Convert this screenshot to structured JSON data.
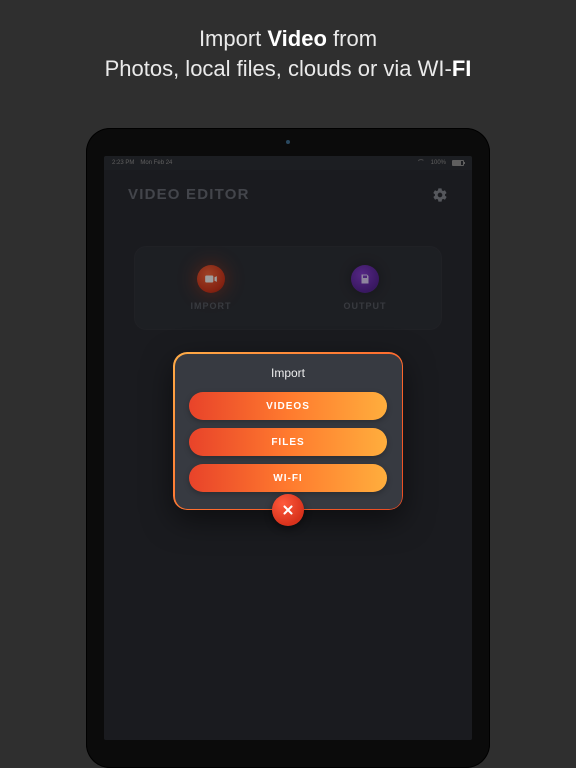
{
  "caption": {
    "l1_pre": "Import ",
    "l1_bold": "Video",
    "l1_post": " from",
    "l2_pre": "Photos, local files, clouds or via WI-",
    "l2_bold": "FI"
  },
  "statusbar": {
    "time": "2:23 PM",
    "date": "Mon Feb 24",
    "battery_pct": "100%"
  },
  "header": {
    "title": "VIDEO EDITOR"
  },
  "tiles": {
    "import_label": "IMPORT",
    "output_label": "OUTPUT"
  },
  "modal": {
    "title": "Import",
    "options": [
      "VIDEOS",
      "FILES",
      "WI-FI"
    ]
  },
  "colors": {
    "page_bg": "#2f2f2f",
    "screen_bg": "#2a2d33",
    "panel_bg": "#303239",
    "modal_bg": "#373a41",
    "grad_start": "#e8432a",
    "grad_end": "#ffae3d"
  }
}
